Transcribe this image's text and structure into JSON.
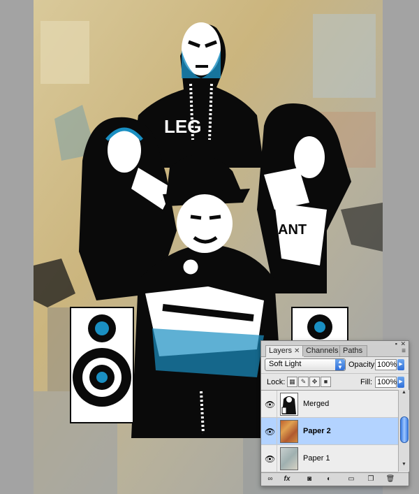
{
  "layers_panel": {
    "tabs": [
      {
        "label": "Layers",
        "close": "✕"
      },
      {
        "label": "Channels"
      },
      {
        "label": "Paths"
      }
    ],
    "blend_mode": "Soft Light",
    "opacity_label": "Opacity:",
    "opacity_value": "100%",
    "lock_label": "Lock:",
    "fill_label": "Fill:",
    "fill_value": "100%",
    "layers": [
      {
        "name": "Merged",
        "visible": true,
        "selected": false
      },
      {
        "name": "Paper 2",
        "visible": true,
        "selected": true
      },
      {
        "name": "Paper 1",
        "visible": true,
        "selected": false
      }
    ]
  },
  "artwork": {
    "shirt_text": "LEG",
    "sleeve_text": "ANT",
    "colors": {
      "accent_blue": "#1a8fc2",
      "ink_black": "#0a0a0a",
      "paper_tan": "#c9b98a"
    }
  }
}
